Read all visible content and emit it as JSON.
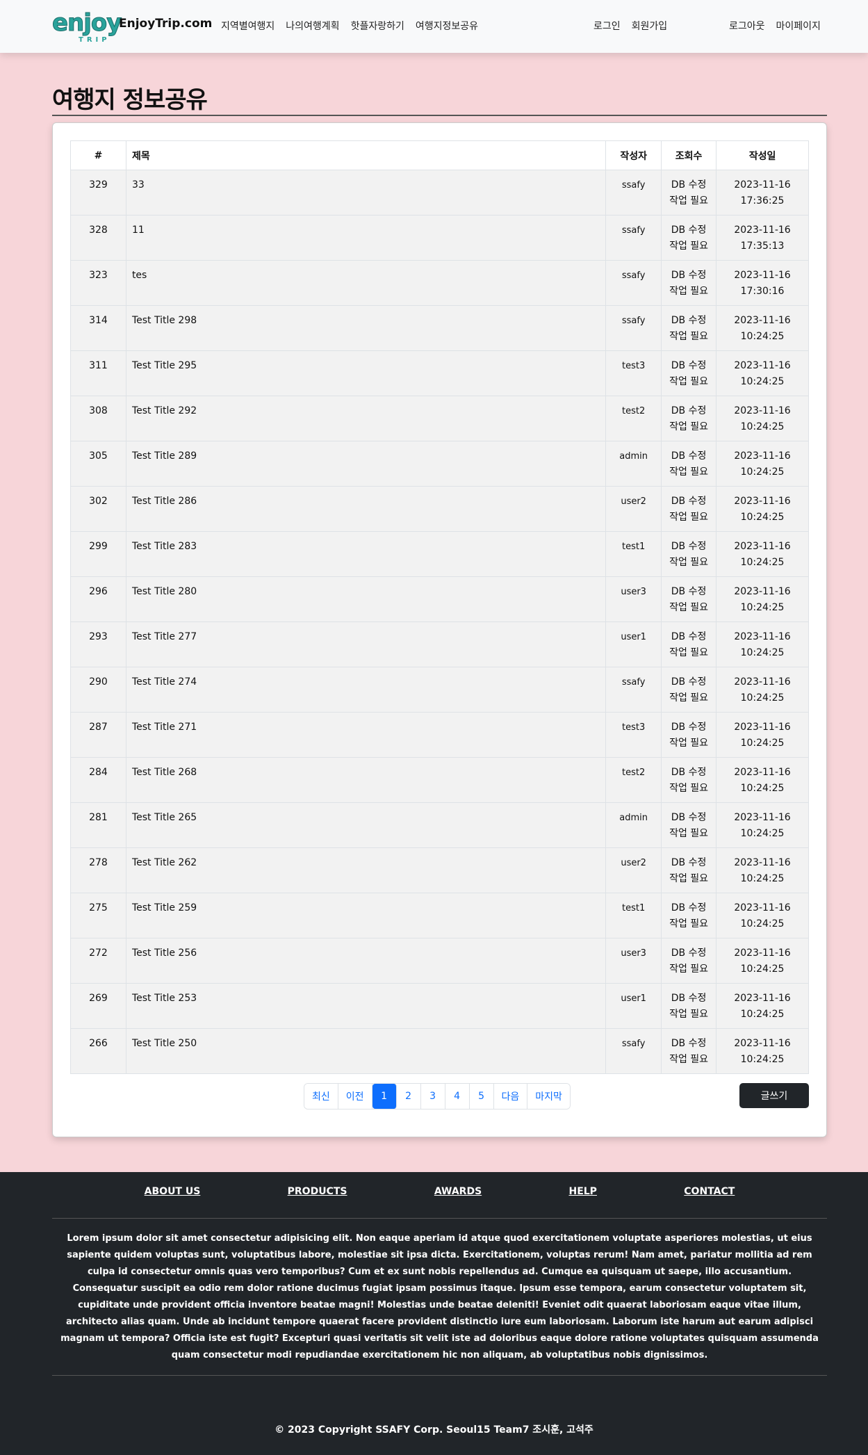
{
  "navbar": {
    "logo_word": "enjoy",
    "logo_sub": "TRIP",
    "brand": "EnjoyTrip.com",
    "left_links": [
      "지역별여행지",
      "나의여행계획",
      "핫플자랑하기",
      "여행지정보공유"
    ],
    "mid_links": [
      "로그인",
      "회원가입"
    ],
    "right_links": [
      "로그아웃",
      "마이페이지"
    ]
  },
  "page": {
    "title": "여행지 정보공유"
  },
  "table": {
    "headers": [
      "#",
      "제목",
      "작성자",
      "조회수",
      "작성일"
    ],
    "rows": [
      {
        "num": "329",
        "title": "33",
        "author": "ssafy",
        "views_line1": "DB 수정",
        "views_line2": "작업 필요",
        "date": "2023-11-16",
        "time": "17:36:25"
      },
      {
        "num": "328",
        "title": "11",
        "author": "ssafy",
        "views_line1": "DB 수정",
        "views_line2": "작업 필요",
        "date": "2023-11-16",
        "time": "17:35:13"
      },
      {
        "num": "323",
        "title": "tes",
        "author": "ssafy",
        "views_line1": "DB 수정",
        "views_line2": "작업 필요",
        "date": "2023-11-16",
        "time": "17:30:16"
      },
      {
        "num": "314",
        "title": "Test Title 298",
        "author": "ssafy",
        "views_line1": "DB 수정",
        "views_line2": "작업 필요",
        "date": "2023-11-16",
        "time": "10:24:25"
      },
      {
        "num": "311",
        "title": "Test Title 295",
        "author": "test3",
        "views_line1": "DB 수정",
        "views_line2": "작업 필요",
        "date": "2023-11-16",
        "time": "10:24:25"
      },
      {
        "num": "308",
        "title": "Test Title 292",
        "author": "test2",
        "views_line1": "DB 수정",
        "views_line2": "작업 필요",
        "date": "2023-11-16",
        "time": "10:24:25"
      },
      {
        "num": "305",
        "title": "Test Title 289",
        "author": "admin",
        "views_line1": "DB 수정",
        "views_line2": "작업 필요",
        "date": "2023-11-16",
        "time": "10:24:25"
      },
      {
        "num": "302",
        "title": "Test Title 286",
        "author": "user2",
        "views_line1": "DB 수정",
        "views_line2": "작업 필요",
        "date": "2023-11-16",
        "time": "10:24:25"
      },
      {
        "num": "299",
        "title": "Test Title 283",
        "author": "test1",
        "views_line1": "DB 수정",
        "views_line2": "작업 필요",
        "date": "2023-11-16",
        "time": "10:24:25"
      },
      {
        "num": "296",
        "title": "Test Title 280",
        "author": "user3",
        "views_line1": "DB 수정",
        "views_line2": "작업 필요",
        "date": "2023-11-16",
        "time": "10:24:25"
      },
      {
        "num": "293",
        "title": "Test Title 277",
        "author": "user1",
        "views_line1": "DB 수정",
        "views_line2": "작업 필요",
        "date": "2023-11-16",
        "time": "10:24:25"
      },
      {
        "num": "290",
        "title": "Test Title 274",
        "author": "ssafy",
        "views_line1": "DB 수정",
        "views_line2": "작업 필요",
        "date": "2023-11-16",
        "time": "10:24:25"
      },
      {
        "num": "287",
        "title": "Test Title 271",
        "author": "test3",
        "views_line1": "DB 수정",
        "views_line2": "작업 필요",
        "date": "2023-11-16",
        "time": "10:24:25"
      },
      {
        "num": "284",
        "title": "Test Title 268",
        "author": "test2",
        "views_line1": "DB 수정",
        "views_line2": "작업 필요",
        "date": "2023-11-16",
        "time": "10:24:25"
      },
      {
        "num": "281",
        "title": "Test Title 265",
        "author": "admin",
        "views_line1": "DB 수정",
        "views_line2": "작업 필요",
        "date": "2023-11-16",
        "time": "10:24:25"
      },
      {
        "num": "278",
        "title": "Test Title 262",
        "author": "user2",
        "views_line1": "DB 수정",
        "views_line2": "작업 필요",
        "date": "2023-11-16",
        "time": "10:24:25"
      },
      {
        "num": "275",
        "title": "Test Title 259",
        "author": "test1",
        "views_line1": "DB 수정",
        "views_line2": "작업 필요",
        "date": "2023-11-16",
        "time": "10:24:25"
      },
      {
        "num": "272",
        "title": "Test Title 256",
        "author": "user3",
        "views_line1": "DB 수정",
        "views_line2": "작업 필요",
        "date": "2023-11-16",
        "time": "10:24:25"
      },
      {
        "num": "269",
        "title": "Test Title 253",
        "author": "user1",
        "views_line1": "DB 수정",
        "views_line2": "작업 필요",
        "date": "2023-11-16",
        "time": "10:24:25"
      },
      {
        "num": "266",
        "title": "Test Title 250",
        "author": "ssafy",
        "views_line1": "DB 수정",
        "views_line2": "작업 필요",
        "date": "2023-11-16",
        "time": "10:24:25"
      }
    ]
  },
  "pagination": {
    "first": "최신",
    "prev": "이전",
    "pages": [
      "1",
      "2",
      "3",
      "4",
      "5"
    ],
    "active_page": "1",
    "next": "다음",
    "last": "마지막"
  },
  "write_button": "글쓰기",
  "footer": {
    "links": [
      "ABOUT US",
      "PRODUCTS",
      "AWARDS",
      "HELP",
      "CONTACT"
    ],
    "text": "Lorem ipsum dolor sit amet consectetur adipisicing elit. Non eaque aperiam id atque quod exercitationem voluptate asperiores molestias, ut eius sapiente quidem voluptas sunt, voluptatibus labore, molestiae sit ipsa dicta. Exercitationem, voluptas rerum! Nam amet, pariatur mollitia ad rem culpa id consectetur omnis quas vero temporibus? Cum et ex sunt nobis repellendus ad. Cumque ea quisquam ut saepe, illo accusantium. Consequatur suscipit ea odio rem dolor ratione ducimus fugiat ipsam possimus itaque. Ipsum esse tempora, earum consectetur voluptatem sit, cupiditate unde provident officia inventore beatae magni! Molestias unde beatae deleniti! Eveniet odit quaerat laboriosam eaque vitae illum, architecto alias quam. Unde ab incidunt tempore quaerat facere provident distinctio iure eum laboriosam. Laborum iste harum aut earum adipisci magnam ut tempora? Officia iste est fugit? Excepturi quasi veritatis sit velit iste ad doloribus eaque dolore ratione voluptates quisquam assumenda quam consectetur modi repudiandae exercitationem hic non aliquam, ab voluptatibus nobis dignissimos.",
    "copyright": "© 2023 Copyright SSAFY Corp. Seoul15 Team7 조시훈, 고석주"
  },
  "colors": {
    "background": "#f7d5d9",
    "navbar": "#f8f9fa",
    "primary": "#0d6efd",
    "dark": "#212529",
    "logo": "#2aa39b"
  }
}
